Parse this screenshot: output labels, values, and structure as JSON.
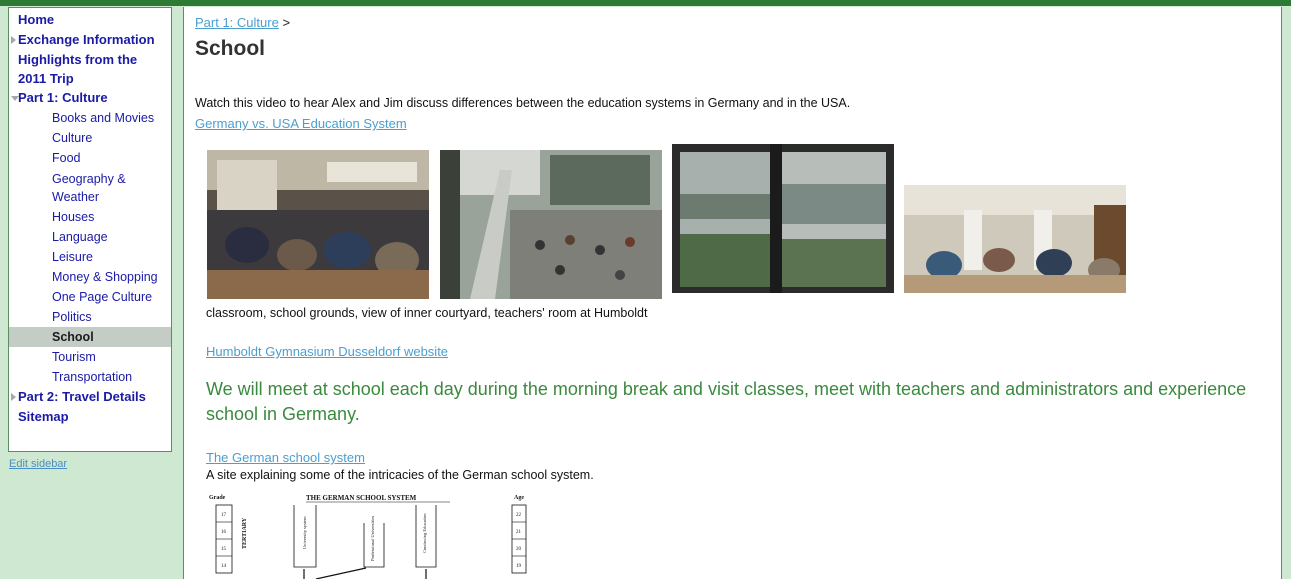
{
  "sidebar": {
    "items": [
      {
        "label": "Home"
      },
      {
        "label": "Exchange Information"
      },
      {
        "label": "Highlights from the 2011 Trip"
      },
      {
        "label": "Part 1: Culture"
      },
      {
        "label": "Books and Movies"
      },
      {
        "label": "Culture"
      },
      {
        "label": "Food"
      },
      {
        "label": "Geography & Weather"
      },
      {
        "label": "Houses"
      },
      {
        "label": "Language"
      },
      {
        "label": "Leisure"
      },
      {
        "label": "Money & Shopping"
      },
      {
        "label": "One Page Culture"
      },
      {
        "label": "Politics"
      },
      {
        "label": "School"
      },
      {
        "label": "Tourism"
      },
      {
        "label": "Transportation"
      },
      {
        "label": "Part 2: Travel Details"
      },
      {
        "label": "Sitemap"
      }
    ],
    "edit_label": "Edit sidebar"
  },
  "breadcrumb": {
    "parent": "Part 1: Culture",
    "separator": ">"
  },
  "page": {
    "title": "School",
    "intro": "Watch this video to hear Alex and Jim discuss differences between the education systems in Germany and in the USA.",
    "video_link": "Germany vs. USA Education System",
    "caption": "classroom, school grounds, view of inner courtyard, teachers' room at Humboldt",
    "humboldt_link": "Humboldt Gymnasium Dusseldorf website",
    "highlight": "We will meet at school each day during the morning break and visit classes, meet with teachers and administrators and experience school in Germany.",
    "school_system_link": "The German school system",
    "school_system_desc": "A site explaining some of the intricacies of the German school system."
  },
  "diagram": {
    "title": "THE GERMAN SCHOOL SYSTEM",
    "grade_label": "Grade",
    "age_label": "Age",
    "grades": [
      "17",
      "16",
      "15",
      "14"
    ],
    "ages": [
      "22",
      "21",
      "20",
      "19"
    ],
    "tertiary": "TERTIARY",
    "boxes": [
      "University system",
      "Professional Universities",
      "Continuing Education"
    ]
  },
  "colors": {
    "accent_green": "#2d7a34",
    "sidebar_bg": "#cfe8d1",
    "link_blue": "#4a9fcf",
    "nav_blue": "#1a1aa6",
    "highlight_green": "#3a8a3e"
  }
}
